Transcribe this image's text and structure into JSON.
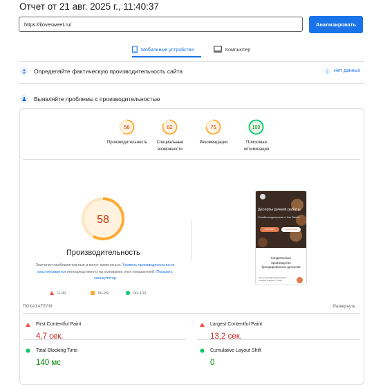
{
  "report": {
    "title": "Отчет от 21 авг. 2025 г., 11:40:37"
  },
  "search": {
    "url": "https://ilovesweet.ru/",
    "analyze_label": "Анализировать"
  },
  "tabs": {
    "mobile": "Мобильные устройства",
    "desktop": "Компьютер"
  },
  "field_section": {
    "title": "Определяйте фактическую производительность сайта",
    "no_data": "Нет данных"
  },
  "lab_section": {
    "title": "Выявляйте проблемы с производительностью"
  },
  "scores": [
    {
      "value": "58",
      "label_line1": "Производительность",
      "label_line2": "",
      "color": "#fa3"
    },
    {
      "value": "82",
      "label_line1": "Специальные",
      "label_line2": "возможности",
      "color": "#fa3"
    },
    {
      "value": "75",
      "label_line1": "Рекомендации",
      "label_line2": "",
      "color": "#fa3"
    },
    {
      "value": "100",
      "label_line1": "Поисковая",
      "label_line2": "оптимизация",
      "color": "#0c6"
    }
  ],
  "performance": {
    "score": "58",
    "label": "Производительность",
    "note_p1": "Значения приблизительные и могут изменяться.",
    "note_link1": "Уровень производительности рассчитывается",
    "note_p2": "непосредственно на основании этих показателей.",
    "note_link2": "Показать калькулятор"
  },
  "legend": {
    "bad": "0–49",
    "mid": "50–89",
    "good": "90–100"
  },
  "metrics_header": "ПОКАЗАТЕЛИ",
  "expand_label": "Развернуть",
  "metrics": {
    "fcp": {
      "name": "First Contentful Paint",
      "value": "4,7 сек."
    },
    "lcp": {
      "name": "Largest Contentful Paint",
      "value": "13,2 сек."
    },
    "tbt": {
      "name": "Total Blocking Time",
      "value": "140 мс"
    },
    "cls": {
      "name": "Cumulative Layout Shift",
      "value": "0"
    }
  },
  "preview": {
    "hero_title": "Десерты ручной работы",
    "hero_sub": "Онлайн-кондитерская «I love Sweet»",
    "btn1": "ЗАКАЗАТЬ",
    "btn2": "ПОДРОБНЕЕ",
    "body_text": "Кондитерское производство брендированных десертов",
    "footer_text": "Мы делаем брендированные сладкие подарки, чтобы..."
  },
  "colors": {
    "accent": "#1a73e8",
    "orange": "#fa3",
    "red": "#c5221f",
    "green": "#0c6"
  }
}
